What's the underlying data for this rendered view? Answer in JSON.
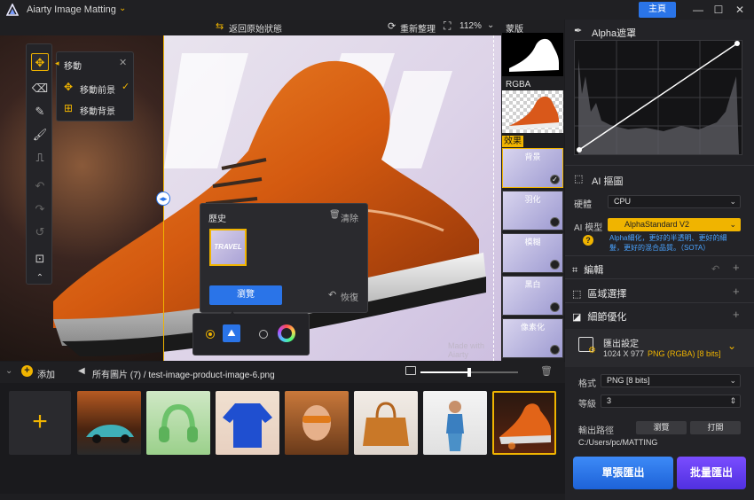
{
  "app": {
    "title": "Aiarty Image Matting",
    "main_button": "主頁"
  },
  "toolbar": {
    "revert": "返回原始狀態",
    "reorganize": "重新整理",
    "zoom": "112%"
  },
  "move_popup": {
    "title": "移動",
    "opt_foreground": "移動前景",
    "opt_background": "移動背景",
    "selected": "移動前景"
  },
  "history": {
    "title": "歷史",
    "clear": "清除",
    "thumb_text": "TRAVEL",
    "browse": "瀏覽",
    "restore": "恢復"
  },
  "canvas": {
    "watermark": "Made with Aiarty"
  },
  "thumbs_column": {
    "mask_label": "蒙版",
    "rgba_label": "RGBA",
    "effect_label": "效果",
    "effects": [
      "背景",
      "羽化",
      "模糊",
      "黑白",
      "像素化"
    ]
  },
  "right_panel": {
    "alpha_title": "Alpha遮罩",
    "ai_matting_title": "AI 摳圖",
    "hardware_label": "硬體",
    "hardware_value": "CPU",
    "model_label": "AI 模型",
    "model_value": "AlphaStandard  V2",
    "model_desc": "Alpha細化，更好的半透明、更好的細髮，更好的混合品質。（SOTA）",
    "sections": {
      "edit": "編輯",
      "region_select": "區域選擇",
      "detail_opt": "細節優化"
    },
    "export": {
      "title": "匯出設定",
      "size": "1024 X 977",
      "format_info": "PNG (RGBA) [8 bits]",
      "format_label": "格式",
      "format_value": "PNG  [8 bits]",
      "level_label": "等級",
      "level_value": "3",
      "path_label": "輸出路徑",
      "browse": "瀏覽",
      "open": "打開",
      "path": "C:/Users/pc/MATTING"
    },
    "btn_single": "單張匯出",
    "btn_batch": "批量匯出"
  },
  "bottom": {
    "add": "添加",
    "all_images": "所有圖片 (7)",
    "separator": "/",
    "filename": "test-image-product-image-6.png",
    "thumb_zoom": 0.5
  },
  "colors": {
    "accent": "#f0b400",
    "primary": "#2a74e8",
    "batch": "#6a3cf0"
  }
}
